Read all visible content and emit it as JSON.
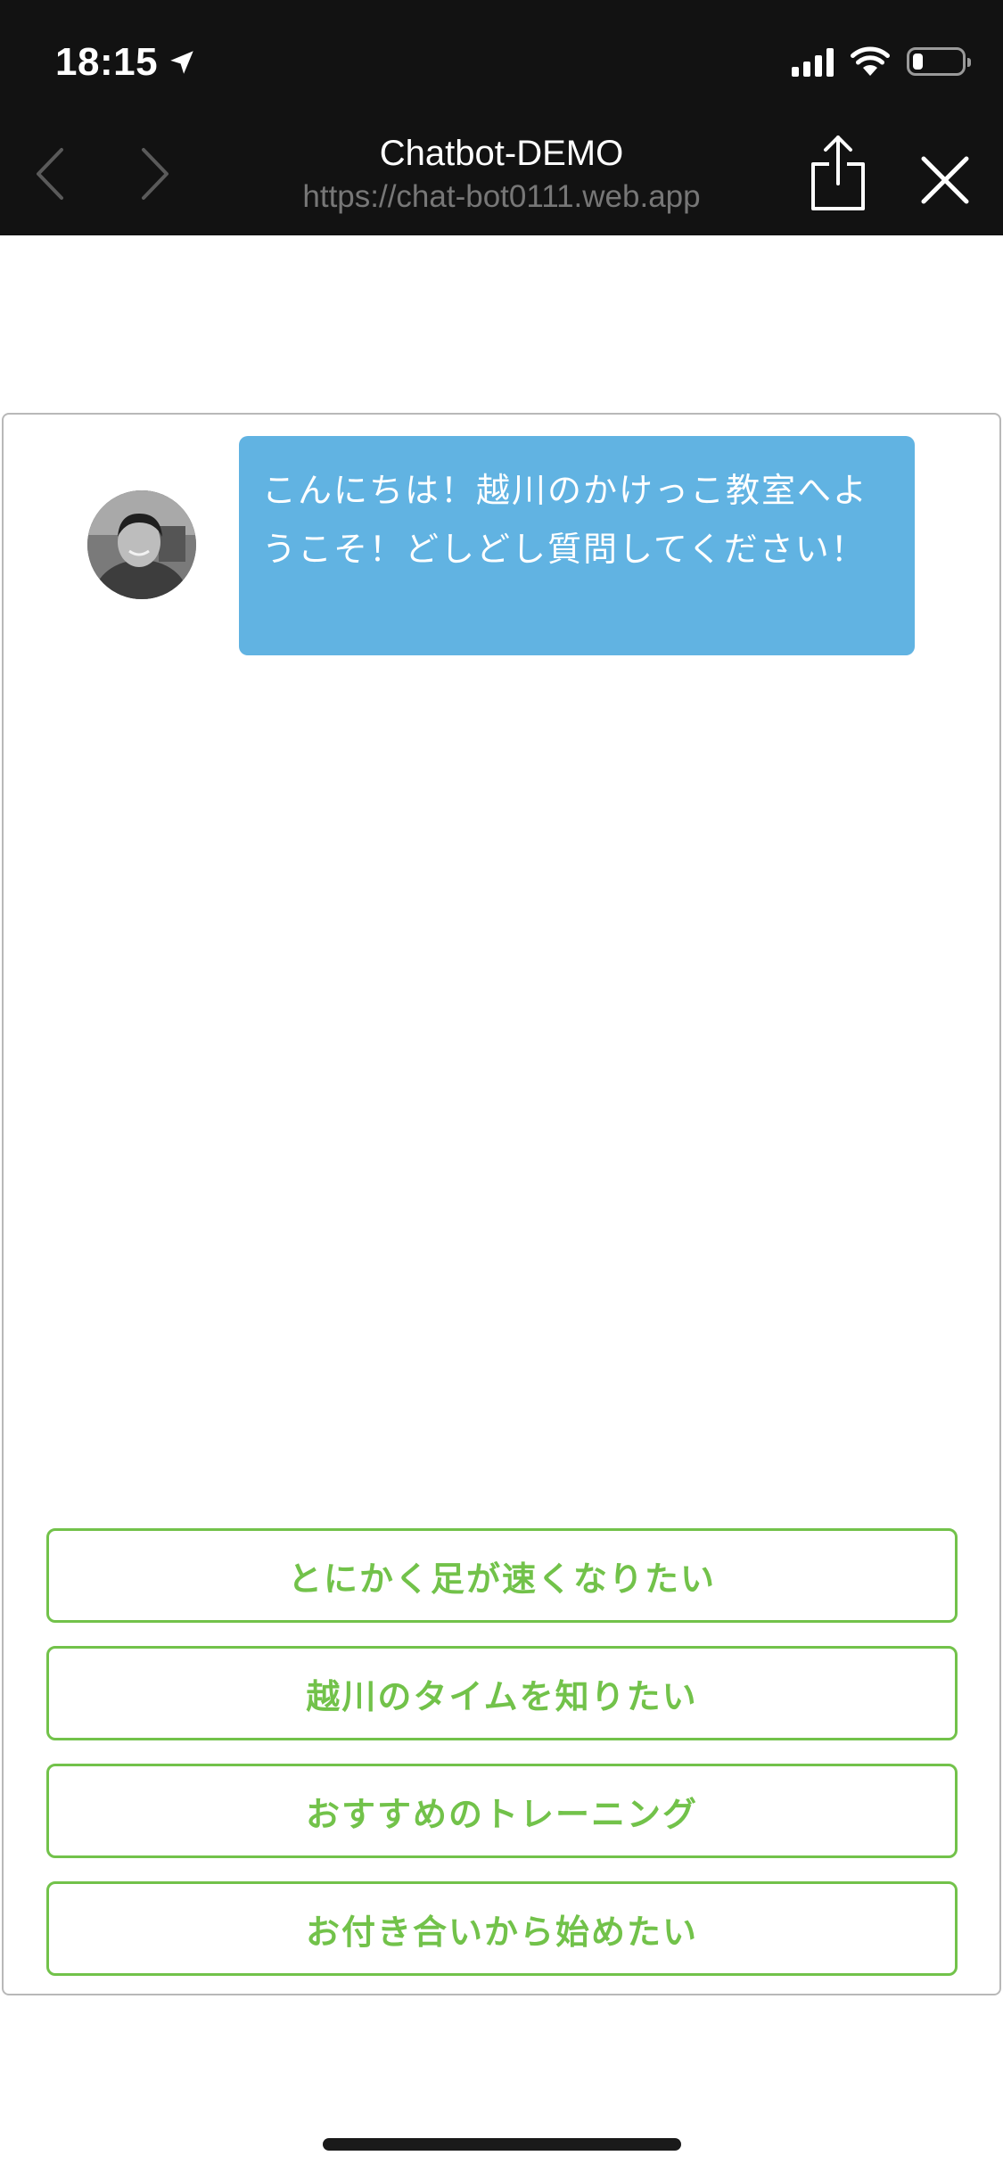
{
  "status_bar": {
    "time": "18:15",
    "icons": [
      "location-arrow-icon",
      "cellular-signal-icon",
      "wifi-icon",
      "battery-icon"
    ],
    "battery_level": 0.2
  },
  "browser": {
    "title": "Chatbot-DEMO",
    "url": "https://chat-bot0111.web.app",
    "icons": [
      "chevron-left-icon",
      "chevron-right-icon",
      "share-icon",
      "close-icon"
    ]
  },
  "chat": {
    "bot_message": "こんにちは！越川のかけっこ教室へようこそ！どしどし質問してください！",
    "bubble_color": "#61b3e2",
    "choices": [
      "とにかく足が速くなりたい",
      "越川のタイムを知りたい",
      "おすすめのトレーニング",
      "お付き合いから始めたい"
    ],
    "choice_color": "#72c24a"
  }
}
